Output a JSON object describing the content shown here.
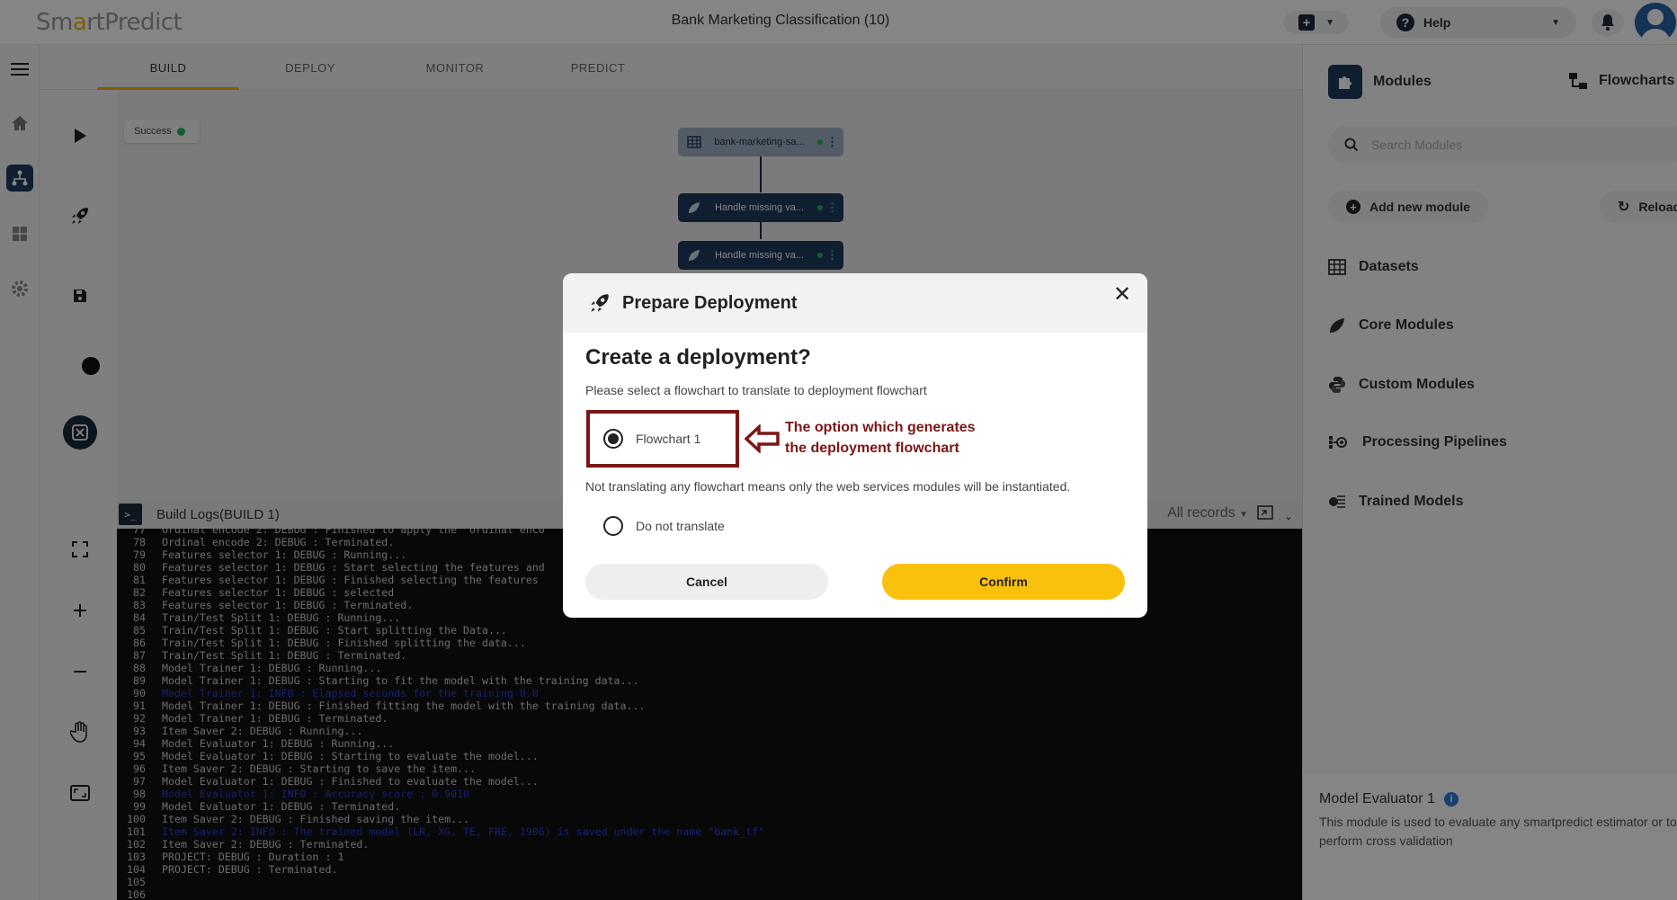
{
  "header": {
    "logo_prefix": "Sm",
    "logo_accent": "a",
    "logo_mid": "rt",
    "logo_suffix": "Predict",
    "project_title": "Bank Marketing Classification (10)",
    "help_label": "Help"
  },
  "tabs": [
    {
      "label": "BUILD",
      "active": true
    },
    {
      "label": "DEPLOY",
      "active": false
    },
    {
      "label": "MONITOR",
      "active": false
    },
    {
      "label": "PREDICT",
      "active": false
    }
  ],
  "canvas": {
    "status": "Success",
    "nodes": [
      {
        "label": "bank-marketing-sa..."
      },
      {
        "label": "Handle missing va..."
      },
      {
        "label": "Handle missing va..."
      }
    ]
  },
  "logs": {
    "title": "Build Logs(BUILD 1)",
    "filter": "All records",
    "lines": [
      {
        "n": "77",
        "text": "Ordinal encode 2: DEBUG : Finished to apply the  ordinal enco",
        "info": false
      },
      {
        "n": "78",
        "text": "Ordinal encode 2: DEBUG : Terminated.",
        "info": false
      },
      {
        "n": "79",
        "text": "Features selector 1: DEBUG : Running...",
        "info": false
      },
      {
        "n": "80",
        "text": "Features selector 1: DEBUG : Start selecting the features and",
        "info": false
      },
      {
        "n": "81",
        "text": "Features selector 1: DEBUG : Finished selecting the features",
        "info": false
      },
      {
        "n": "82",
        "text": "Features selector 1: DEBUG : selected",
        "info": false
      },
      {
        "n": "83",
        "text": "Features selector 1: DEBUG : Terminated.",
        "info": false
      },
      {
        "n": "84",
        "text": "Train/Test Split 1: DEBUG : Running...",
        "info": false
      },
      {
        "n": "85",
        "text": "Train/Test Split 1: DEBUG : Start splitting the Data...",
        "info": false
      },
      {
        "n": "86",
        "text": "Train/Test Split 1: DEBUG : Finished splitting the data...",
        "info": false
      },
      {
        "n": "87",
        "text": "Train/Test Split 1: DEBUG : Terminated.",
        "info": false
      },
      {
        "n": "88",
        "text": "Model Trainer 1: DEBUG : Running...",
        "info": false
      },
      {
        "n": "89",
        "text": "Model Trainer 1: DEBUG : Starting to fit the model with the training data...",
        "info": false
      },
      {
        "n": "90",
        "text": "Model Trainer 1: INFO : Elapsed seconds for the training 0.0",
        "info": true
      },
      {
        "n": "91",
        "text": "Model Trainer 1: DEBUG : Finished fitting the model with the training data...",
        "info": false
      },
      {
        "n": "92",
        "text": "Model Trainer 1: DEBUG : Terminated.",
        "info": false
      },
      {
        "n": "93",
        "text": "Item Saver 2: DEBUG : Running...",
        "info": false
      },
      {
        "n": "94",
        "text": "Model Evaluator 1: DEBUG : Running...",
        "info": false
      },
      {
        "n": "95",
        "text": "Model Evaluator 1: DEBUG : Starting to evaluate the model...",
        "info": false
      },
      {
        "n": "96",
        "text": "Item Saver 2: DEBUG : Starting to save the item...",
        "info": false
      },
      {
        "n": "97",
        "text": "Model Evaluator 1: DEBUG : Finished to evaluate the model...",
        "info": false
      },
      {
        "n": "98",
        "text": "Model Evaluator 1: INFO : Accuracy score : 0.9010",
        "info": true
      },
      {
        "n": "99",
        "text": "Model Evaluator 1: DEBUG : Terminated.",
        "info": false
      },
      {
        "n": "100",
        "text": "Item Saver 2: DEBUG : Finished saving the item...",
        "info": false
      },
      {
        "n": "101",
        "text": "Item Saver 2: INFO : The trained model (LR, XG, TE, FRE, 1906) is saved under the name \"bank_tf\"",
        "info": true
      },
      {
        "n": "102",
        "text": "Item Saver 2: DEBUG : Terminated.",
        "info": false
      },
      {
        "n": "103",
        "text": "PROJECT: DEBUG : Duration : 1",
        "info": false
      },
      {
        "n": "104",
        "text": "PROJECT: DEBUG : Terminated.",
        "info": false
      },
      {
        "n": "105",
        "text": "",
        "info": false
      },
      {
        "n": "106",
        "text": "",
        "info": false
      }
    ]
  },
  "right_panel": {
    "tab_modules": "Modules",
    "tab_flowcharts": "Flowcharts",
    "search_placeholder": "Search Modules",
    "add_module": "Add new module",
    "reload": "Reload",
    "categories": [
      "Datasets",
      "Core Modules",
      "Custom Modules",
      "Processing Pipelines",
      "Trained Models"
    ],
    "selected_title": "Model Evaluator 1",
    "selected_desc": "This module is used to evaluate any smartpredict estimator or to perform cross validation"
  },
  "modal": {
    "title": "Prepare Deployment",
    "heading": "Create a deployment?",
    "prompt": "Please select a flowchart to translate to deployment flowchart",
    "option_1": "Flowchart 1",
    "annotation_line1": "The option which generates",
    "annotation_line2": "the deployment flowchart",
    "note": "Not translating any flowchart means only the web services modules will be instantiated.",
    "option_2": "Do not translate",
    "cancel": "Cancel",
    "confirm": "Confirm"
  },
  "colors": {
    "accent": "#f9c10b",
    "navy": "#1e3a5f",
    "annotation": "#7b1616"
  }
}
